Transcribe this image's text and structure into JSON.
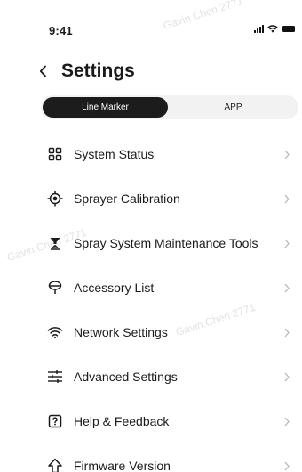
{
  "watermark": "Gavin.Chen 2771",
  "status_bar": {
    "time": "9:41"
  },
  "header": {
    "title": "Settings"
  },
  "tabs": [
    {
      "label": "Line Marker",
      "active": true
    },
    {
      "label": "APP",
      "active": false
    }
  ],
  "menu": [
    {
      "label": "System Status",
      "icon": "grid-icon"
    },
    {
      "label": "Sprayer Calibration",
      "icon": "crosshair-icon"
    },
    {
      "label": "Spray System Maintenance Tools",
      "icon": "spray-nozzle-icon"
    },
    {
      "label": "Accessory List",
      "icon": "accessory-icon"
    },
    {
      "label": "Network Settings",
      "icon": "wifi-icon"
    },
    {
      "label": "Advanced Settings",
      "icon": "sliders-icon"
    },
    {
      "label": "Help & Feedback",
      "icon": "help-icon"
    },
    {
      "label": "Firmware Version",
      "icon": "upgrade-arrow-icon"
    }
  ],
  "colors": {
    "active_tab_bg": "#1c1c1c",
    "segment_bg": "#f2f2f2",
    "chevron": "#b5b5b5"
  }
}
